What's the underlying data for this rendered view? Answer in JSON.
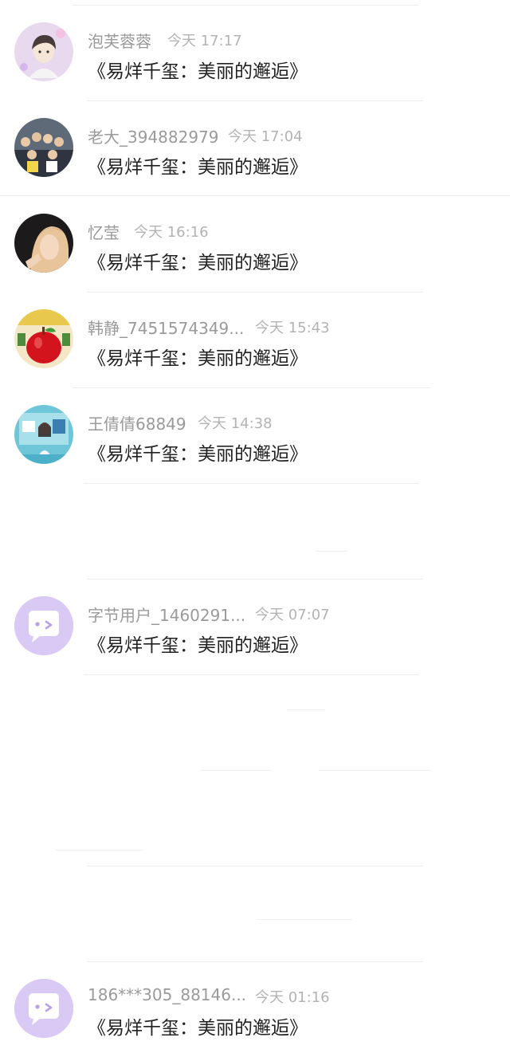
{
  "conversations": [
    {
      "name": "泡芙蓉蓉",
      "time": "今天 17:17",
      "message": "《易烊千玺：美丽的邂逅》",
      "avatar": "anime-girl-avatar"
    },
    {
      "name": "老大_394882979",
      "time": "今天 17:04",
      "message": "《易烊千玺：美丽的邂逅》",
      "avatar": "group-photo-avatar"
    },
    {
      "name": "忆莹",
      "time": "今天 16:16",
      "message": "《易烊千玺：美丽的邂逅》",
      "avatar": "blonde-portrait-avatar"
    },
    {
      "name": "韩静_7451574349...",
      "time": "今天 15:43",
      "message": "《易烊千玺：美丽的邂逅》",
      "avatar": "red-apple-avatar"
    },
    {
      "name": "王倩倩68849",
      "time": "今天 14:38",
      "message": "《易烊千玺：美丽的邂逅》",
      "avatar": "blue-photo-avatar"
    },
    {
      "name": "字节用户_1460291...",
      "time": "今天 07:07",
      "message": "《易烊千玺：美丽的邂逅》",
      "avatar": "default-chat-bubble-avatar"
    },
    {
      "name": "186***305_88146...",
      "time": "今天 01:16",
      "message": "《易烊千玺：美丽的邂逅》",
      "avatar": "default-chat-bubble-avatar"
    }
  ],
  "colors": {
    "default_avatar_bg": "#d9c9f5",
    "name_text": "#9a9a9a",
    "time_text": "#b3b3b3",
    "message_text": "#222222"
  }
}
